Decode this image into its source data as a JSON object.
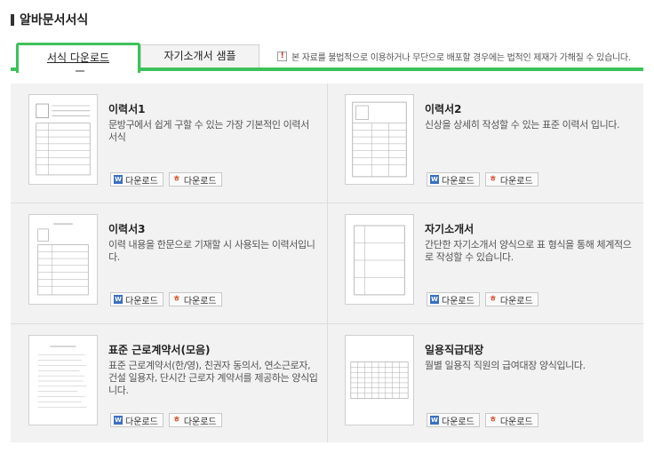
{
  "page": {
    "title": "알바문서서식"
  },
  "tabs": [
    {
      "label": "서식 다운로드"
    },
    {
      "label": "자기소개서 샘플"
    }
  ],
  "notice": {
    "icon": "!",
    "text": "본 자료를 불법적으로 이용하거나 무단으로 배포할 경우에는 법적인 제재가 가해질 수 있습니다."
  },
  "download_labels": {
    "word": "다운로드",
    "hwp": "다운로드"
  },
  "button_icons": {
    "word": "W",
    "hwp": "ㅎ"
  },
  "cards": [
    {
      "title": "이력서1",
      "desc": "문방구에서 쉽게 구할 수 있는 가장 기본적인 이력서 서식"
    },
    {
      "title": "이력서2",
      "desc": "신상을 상세히 작성할 수 있는 표준 이력서 입니다."
    },
    {
      "title": "이력서3",
      "desc": "이력 내용을 한문으로 기재할 시 사용되는 이력서입니다."
    },
    {
      "title": "자기소개서",
      "desc": "간단한 자기소개서 양식으로 표 형식을 통해 체계적으로 작성할 수 있습니다."
    },
    {
      "title": "표준 근로계약서(모음)",
      "desc": "표준 근로계약서(한/영), 친권자 동의서, 연소근로자, 건설 일용자, 단시간 근로자 계약서를 제공하는 양식입니다."
    },
    {
      "title": "일용직급대장",
      "desc": "월별 일용직 직원의 급여대장 양식입니다."
    }
  ],
  "colors": {
    "accent": "#3cc25a",
    "word_icon": "#3a6fc2",
    "hwp_icon": "#d24b2a",
    "grid_bg": "#f2f2f2"
  }
}
